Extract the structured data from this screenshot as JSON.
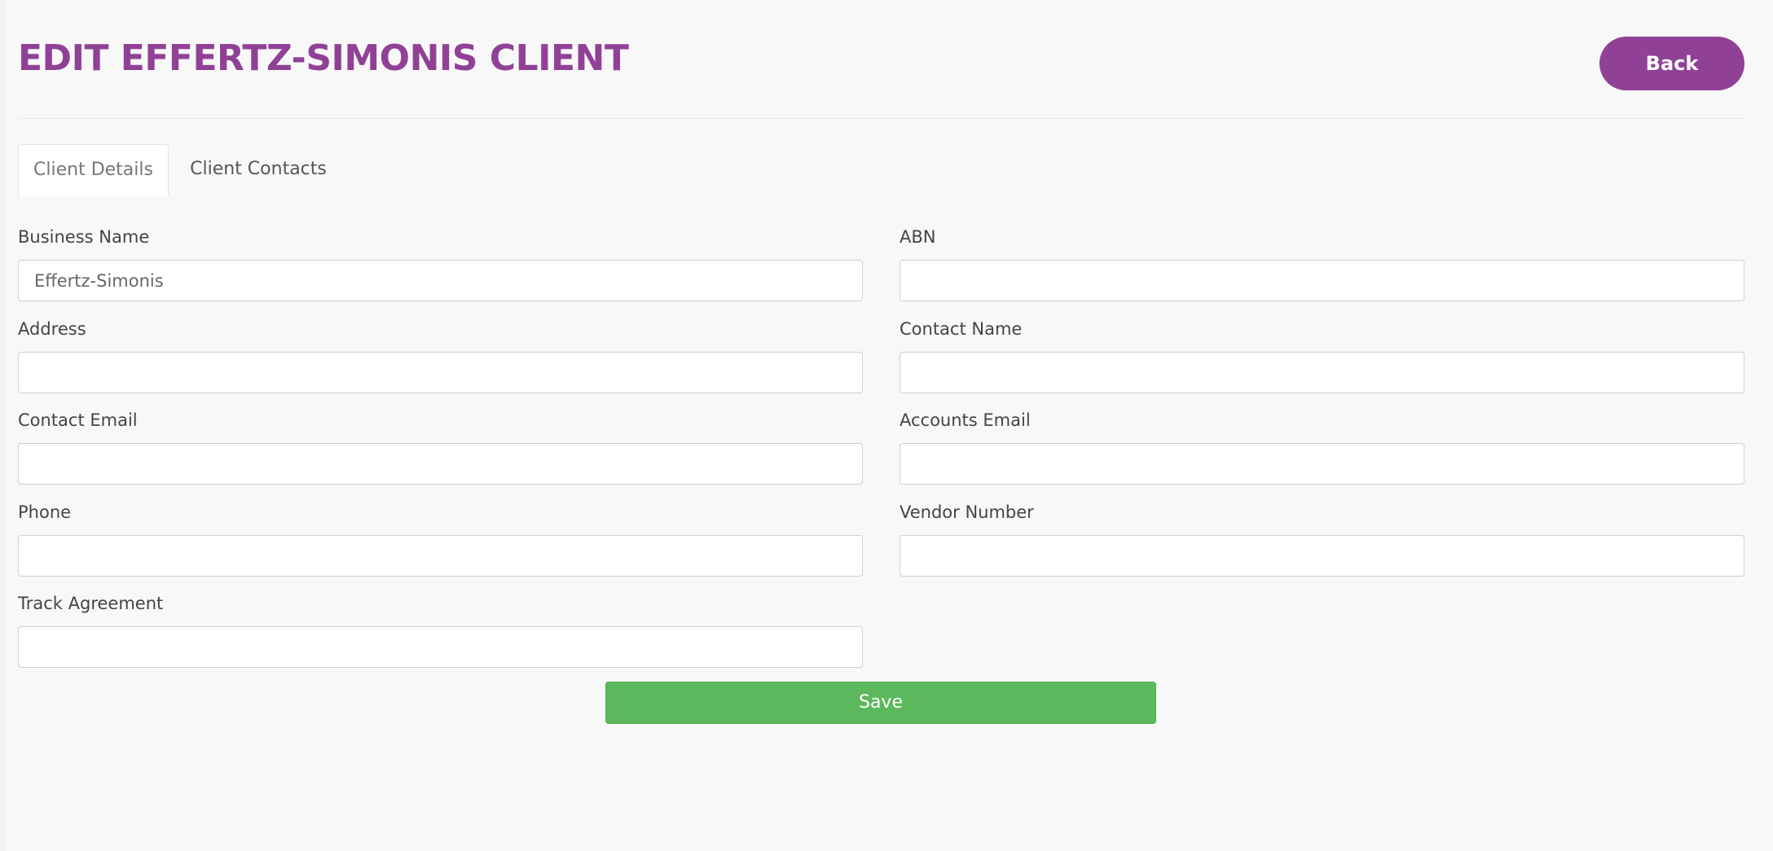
{
  "header": {
    "title": "EDIT EFFERTZ-SIMONIS CLIENT",
    "back_label": "Back"
  },
  "tabs": [
    {
      "label": "Client Details",
      "active": true
    },
    {
      "label": "Client Contacts",
      "active": false
    }
  ],
  "form": {
    "business_name": {
      "label": "Business Name",
      "value": "Effertz-Simonis"
    },
    "abn": {
      "label": "ABN",
      "value": ""
    },
    "address": {
      "label": "Address",
      "value": ""
    },
    "contact_name": {
      "label": "Contact Name",
      "value": ""
    },
    "contact_email": {
      "label": "Contact Email",
      "value": ""
    },
    "accounts_email": {
      "label": "Accounts Email",
      "value": ""
    },
    "phone": {
      "label": "Phone",
      "value": ""
    },
    "vendor_number": {
      "label": "Vendor Number",
      "value": ""
    },
    "track_agreement": {
      "label": "Track Agreement",
      "value": ""
    },
    "save_label": "Save"
  },
  "colors": {
    "brand": "#904196",
    "save": "#5cb85c",
    "background": "#f8f8f8"
  }
}
